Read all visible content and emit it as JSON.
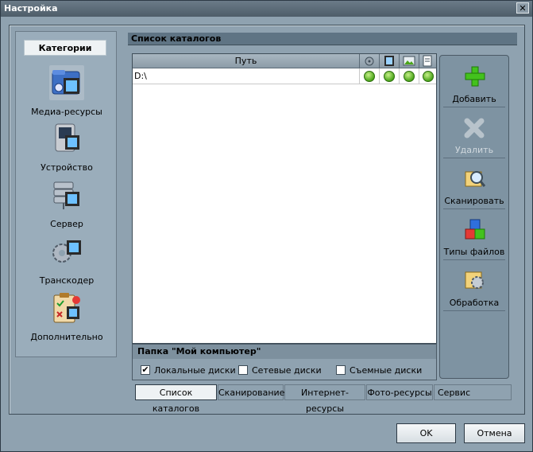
{
  "window": {
    "title": "Настройка",
    "close_symbol": "✕"
  },
  "categories": {
    "header": "Категории",
    "items": [
      {
        "label": "Медиа-ресурсы",
        "icon": "media-folder-icon",
        "selected": true
      },
      {
        "label": "Устройство",
        "icon": "device-icon",
        "selected": false
      },
      {
        "label": "Сервер",
        "icon": "server-icon",
        "selected": false
      },
      {
        "label": "Транскодер",
        "icon": "transcoder-gears-icon",
        "selected": false
      },
      {
        "label": "Дополнительно",
        "icon": "clipboard-checklist-icon",
        "selected": false
      }
    ]
  },
  "catalog": {
    "title": "Список каталогов",
    "column_path": "Путь",
    "column_icons": [
      "music-icon",
      "film-icon",
      "photo-icon",
      "document-icon"
    ],
    "rows": [
      {
        "path": "D:\\",
        "flags": [
          true,
          true,
          true,
          true
        ]
      }
    ]
  },
  "toolbar": {
    "add": "Добавить",
    "delete": "Удалить",
    "scan": "Сканировать",
    "file_types": "Типы файлов",
    "processing": "Обработка"
  },
  "my_computer": {
    "title": "Папка \"Мой компьютер\"",
    "local": {
      "label": "Локальные диски",
      "checked": true
    },
    "network": {
      "label": "Сетевые диски",
      "checked": false
    },
    "removable": {
      "label": "Съемные диски",
      "checked": false
    }
  },
  "tabs": [
    "Список каталогов",
    "Сканирование",
    "Интернет-ресурсы",
    "Фото-ресурсы",
    "Сервис"
  ],
  "buttons": {
    "ok": "OK",
    "cancel": "Отмена"
  },
  "colors": {
    "accent": "#5f7484",
    "window_bg": "#8fa2b0",
    "check_green": "#4aa51a"
  }
}
